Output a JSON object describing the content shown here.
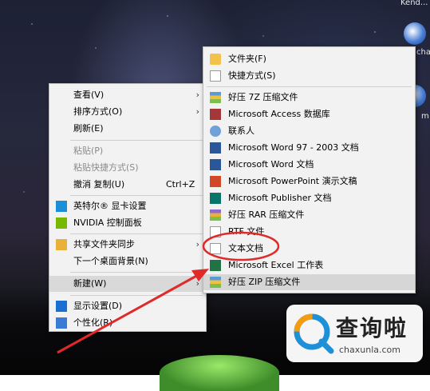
{
  "desktop": {
    "icon_labels": [
      "Kend...",
      "chan...",
      "m"
    ]
  },
  "context_menu": {
    "items": [
      {
        "label": "查看(V)",
        "arrow": "›"
      },
      {
        "label": "排序方式(O)",
        "arrow": "›"
      },
      {
        "label": "刷新(E)"
      },
      {
        "label": "粘贴(P)"
      },
      {
        "label": "粘贴快捷方式(S)"
      },
      {
        "label": "撤消 复制(U)",
        "shortcut": "Ctrl+Z"
      },
      {
        "label": "英特尔® 显卡设置"
      },
      {
        "label": "NVIDIA 控制面板"
      },
      {
        "label": "共享文件夹同步",
        "arrow": "›"
      },
      {
        "label": "下一个桌面背景(N)"
      },
      {
        "label": "新建(W)",
        "arrow": "›"
      },
      {
        "label": "显示设置(D)"
      },
      {
        "label": "个性化(R)"
      }
    ]
  },
  "new_submenu": {
    "items": [
      {
        "label": "文件夹(F)",
        "icon": "folder-icon"
      },
      {
        "label": "快捷方式(S)",
        "icon": "shortcut-icon"
      },
      {
        "label": "好压 7Z 压缩文件",
        "icon": "archive-icon"
      },
      {
        "label": "Microsoft Access 数据库",
        "icon": "access-icon"
      },
      {
        "label": "联系人",
        "icon": "contact-icon"
      },
      {
        "label": "Microsoft Word 97 - 2003 文档",
        "icon": "word-icon"
      },
      {
        "label": "Microsoft Word 文档",
        "icon": "word-icon"
      },
      {
        "label": "Microsoft PowerPoint 演示文稿",
        "icon": "powerpoint-icon"
      },
      {
        "label": "Microsoft Publisher 文档",
        "icon": "publisher-icon"
      },
      {
        "label": "好压 RAR 压缩文件",
        "icon": "archive-icon"
      },
      {
        "label": "RTF 文件",
        "icon": "document-icon"
      },
      {
        "label": "文本文档",
        "icon": "text-file-icon"
      },
      {
        "label": "Microsoft Excel 工作表",
        "icon": "excel-icon"
      },
      {
        "label": "好压 ZIP 压缩文件",
        "icon": "archive-icon"
      }
    ]
  },
  "annotation": {
    "color": "#e02a2a"
  },
  "watermark": {
    "title": "查询啦",
    "domain": "chaxunla.com"
  }
}
